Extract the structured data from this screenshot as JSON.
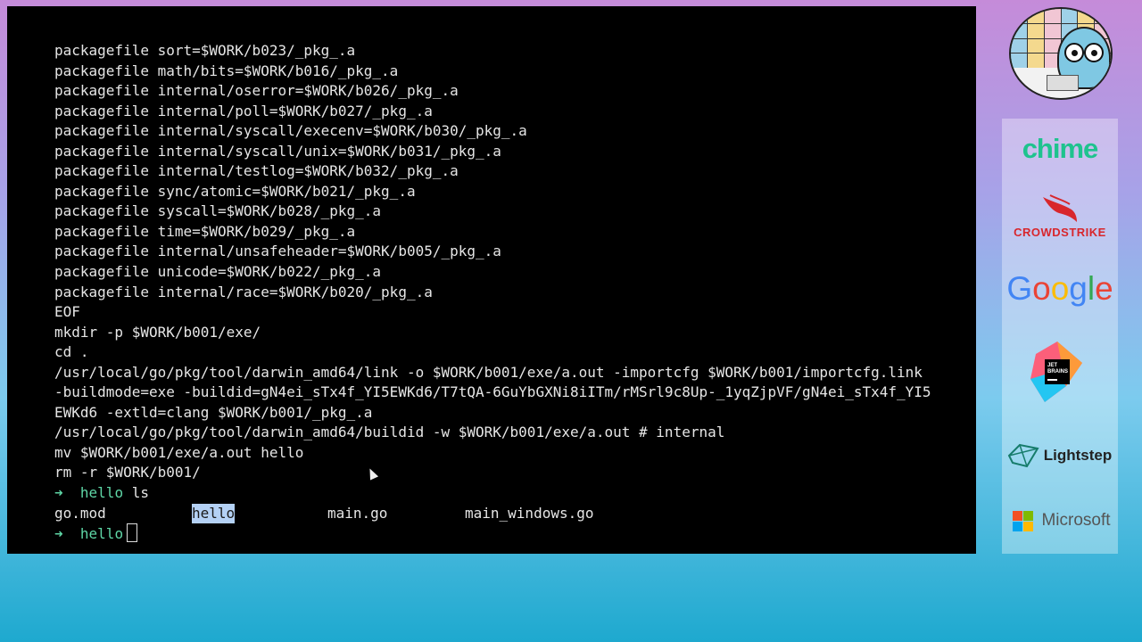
{
  "terminal": {
    "lines": [
      "packagefile sort=$WORK/b023/_pkg_.a",
      "packagefile math/bits=$WORK/b016/_pkg_.a",
      "packagefile internal/oserror=$WORK/b026/_pkg_.a",
      "packagefile internal/poll=$WORK/b027/_pkg_.a",
      "packagefile internal/syscall/execenv=$WORK/b030/_pkg_.a",
      "packagefile internal/syscall/unix=$WORK/b031/_pkg_.a",
      "packagefile internal/testlog=$WORK/b032/_pkg_.a",
      "packagefile sync/atomic=$WORK/b021/_pkg_.a",
      "packagefile syscall=$WORK/b028/_pkg_.a",
      "packagefile time=$WORK/b029/_pkg_.a",
      "packagefile internal/unsafeheader=$WORK/b005/_pkg_.a",
      "packagefile unicode=$WORK/b022/_pkg_.a",
      "packagefile internal/race=$WORK/b020/_pkg_.a",
      "EOF",
      "mkdir -p $WORK/b001/exe/",
      "cd .",
      "/usr/local/go/pkg/tool/darwin_amd64/link -o $WORK/b001/exe/a.out -importcfg $WORK/b001/importcfg.link",
      "-buildmode=exe -buildid=gN4ei_sTx4f_YI5EWKd6/T7tQA-6GuYbGXNi8iITm/rMSrl9c8Up-_1yqZjpVF/gN4ei_sTx4f_YI5",
      "EWKd6 -extld=clang $WORK/b001/_pkg_.a",
      "/usr/local/go/pkg/tool/darwin_amd64/buildid -w $WORK/b001/exe/a.out # internal",
      "mv $WORK/b001/exe/a.out hello",
      "rm -r $WORK/b001/"
    ],
    "prompt_arrow": "➜",
    "prompt_dir": "hello",
    "command": "ls",
    "ls_output": [
      "go.mod",
      "hello",
      "main.go",
      "main_windows.go"
    ]
  },
  "sponsors": {
    "chime": "chime",
    "crowdstrike": "CROWDSTRIKE",
    "google": "Google",
    "jetbrains_line1": "JET",
    "jetbrains_line2": "BRAINS",
    "lightstep": "Lightstep",
    "microsoft": "Microsoft"
  },
  "colors": {
    "prompt_arrow": "#5fd7a7",
    "selection": "#b4d1f5",
    "chime": "#1ec38e",
    "crowdstrike": "#d8262c"
  }
}
